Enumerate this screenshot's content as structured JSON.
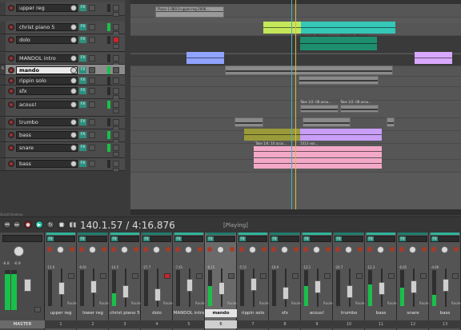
{
  "tracks": [
    {
      "num": "",
      "name": "upper reg",
      "fx": "FX",
      "meter": false,
      "mute": false
    },
    {
      "num": "",
      "name": "christ piano 5",
      "fx": "FX",
      "meter": true,
      "mute": false
    },
    {
      "num": "",
      "name": "dolo",
      "fx": "FX",
      "meter": false,
      "mute": true
    },
    {
      "num": "",
      "name": "MANDOL intro",
      "fx": "FX",
      "meter": false,
      "mute": false
    },
    {
      "num": "6",
      "name": "mando",
      "fx": "FX",
      "meter": true,
      "mute": false,
      "selected": true
    },
    {
      "num": "",
      "name": "rippin solo",
      "fx": "FX",
      "meter": false,
      "mute": false
    },
    {
      "num": "",
      "name": "sfx",
      "fx": "FX",
      "meter": false,
      "mute": false
    },
    {
      "num": "",
      "name": "acous!",
      "fx": "FX",
      "meter": true,
      "mute": false
    },
    {
      "num": "",
      "name": "trumbo",
      "fx": "FX",
      "meter": false,
      "mute": false
    },
    {
      "num": "",
      "name": "bass",
      "fx": "FX",
      "meter": true,
      "mute": false
    },
    {
      "num": "",
      "name": "snare",
      "fx": "FX",
      "meter": true,
      "mute": false
    },
    {
      "num": "",
      "name": "bass",
      "fx": "FX",
      "meter": false,
      "mute": false
    }
  ],
  "items": {
    "top": "Piano-1-080.0-upper-reg-2006...",
    "t1": "Take 1/2: 08 acou...",
    "t2": "Take 1/2: 08 acou...",
    "t3": "Take 1/2: 08 acou...",
    "t4": "Take 1/2: 08 acou...",
    "t5": "Take 1/4: 10 acou...",
    "t6": "1413 vox..."
  },
  "colors": {
    "accent": "#1fb99a",
    "rec": "#8b2020",
    "mute": "#c8252c",
    "cursor": "#d9b84a"
  },
  "transport": {
    "time": "140.1.57 / 4:16.876",
    "state": "[Playing]",
    "timeline_label": "Scroll timeline"
  },
  "master": {
    "name": "MASTER",
    "db_l": "-6.8",
    "db_r": "-6.9"
  },
  "mixer": [
    {
      "name": "upper reg",
      "num": "1",
      "db": "-13.0",
      "meter": 0.0,
      "mute": false
    },
    {
      "name": "lower reg",
      "num": "2",
      "db": "-9.91",
      "meter": 0.0,
      "mute": false
    },
    {
      "name": "christ piano 5",
      "num": "3",
      "db": "-14.5",
      "meter": 0.35,
      "mute": false
    },
    {
      "name": "dolo",
      "num": "4",
      "db": "-27.7",
      "meter": 0.0,
      "mute": true
    },
    {
      "name": "MANDOL intro",
      "num": "5",
      "db": "-7.41",
      "meter": 0.0,
      "mute": false
    },
    {
      "name": "mando",
      "num": "6",
      "db": "-8.15",
      "meter": 0.55,
      "mute": false,
      "selected": true
    },
    {
      "name": "rippin solo",
      "num": "7",
      "db": "-5.51",
      "meter": 0.0,
      "mute": false
    },
    {
      "name": "sfx",
      "num": "8",
      "db": "-18.9",
      "meter": 0.0,
      "mute": false
    },
    {
      "name": "acous!",
      "num": "9",
      "db": "-13.1",
      "meter": 0.55,
      "mute": false
    },
    {
      "name": "trumbo",
      "num": "10",
      "db": "-20.7",
      "meter": 0.0,
      "mute": false
    },
    {
      "name": "bass",
      "num": "11",
      "db": "-12.3",
      "meter": 0.6,
      "mute": false
    },
    {
      "name": "snare",
      "num": "12",
      "db": "-6.65",
      "meter": 0.5,
      "mute": false
    },
    {
      "name": "bass",
      "num": "13",
      "db": "-4.69",
      "meter": 0.3,
      "mute": false
    }
  ]
}
